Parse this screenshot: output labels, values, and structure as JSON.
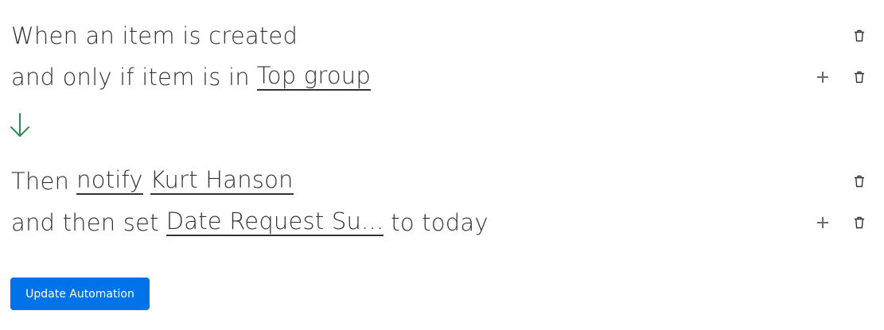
{
  "trigger": {
    "line1": "When an item is created",
    "condition_prefix": "and only if item is in",
    "condition_value": "Top group"
  },
  "actions": {
    "action_prefix": "Then",
    "action_verb": "notify",
    "action_target": "Kurt Hanson",
    "second_prefix": "and then set",
    "second_field": "Date Request Su...",
    "second_suffix": "to today"
  },
  "button": {
    "label": "Update Automation"
  },
  "colors": {
    "accent": "#0073ea",
    "arrow": "#2e8b57",
    "text": "#323338",
    "icon": "#676879"
  },
  "icons": [
    "add-condition-icon",
    "delete-icon",
    "flow-arrow-down-icon"
  ]
}
